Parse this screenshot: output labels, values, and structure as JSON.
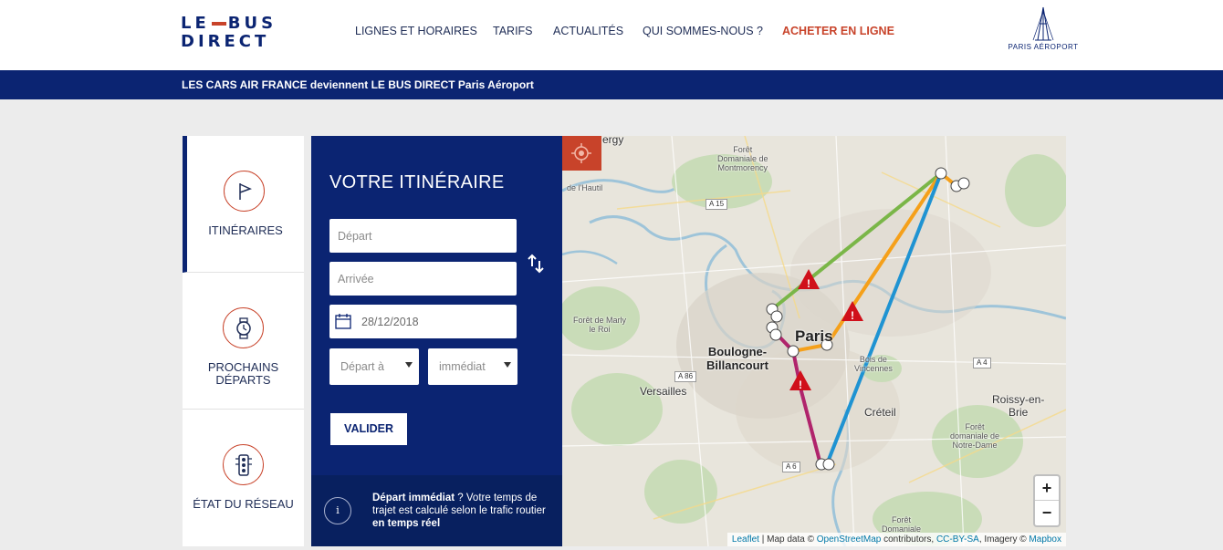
{
  "header": {
    "logo": {
      "line1_a": "LE",
      "line1_b": "BUS",
      "line2": "DIRECT"
    },
    "nav": [
      {
        "label": "LIGNES ET HORAIRES"
      },
      {
        "label": "TARIFS"
      },
      {
        "label": "ACTUALITÉS"
      },
      {
        "label": "QUI SOMMES-NOUS ?"
      },
      {
        "label": "ACHETER EN LIGNE"
      }
    ],
    "partner_logo": "PARIS AÉROPORT"
  },
  "banner": {
    "text": "LES CARS AIR FRANCE deviennent LE BUS DIRECT Paris Aéroport"
  },
  "sidebar": {
    "items": [
      {
        "label": "ITINÉRAIRES",
        "icon": "flag-icon",
        "active": true
      },
      {
        "label": "PROCHAINS DÉPARTS",
        "icon": "watch-icon",
        "active": false
      },
      {
        "label": "ÉTAT DU RÉSEAU",
        "icon": "traffic-light-icon",
        "active": false
      }
    ]
  },
  "form": {
    "title": "VOTRE ITINÉRAIRE",
    "depart_placeholder": "Départ",
    "arrivee_placeholder": "Arrivée",
    "date_value": "28/12/2018",
    "time_mode": "Départ à",
    "time_value": "immédiat",
    "submit_label": "VALIDER",
    "info": {
      "bold1": "Départ immédiat",
      "text1": " ? Votre temps de trajet est calculé selon le trafic routier ",
      "bold2": "en temps réel"
    }
  },
  "map": {
    "labels": {
      "paris": "Paris",
      "boulogne": "Boulogne-\nBillancourt",
      "versailles": "Versailles",
      "creteil": "Créteil",
      "roissy": "Roissy-en-\nBrie",
      "marly": "Forêt de Marly\nle Roi",
      "montmorency": "Forêt\nDomaniale de\nMontmorency",
      "hautil": "de l'Hautil",
      "vincennes": "Bois de\nVincennes",
      "notredame": "Forêt\ndomaniale de\nNotre-Dame",
      "ergy": "ergy",
      "foret_bottom": "Forêt\nDomaniale",
      "a15": "A 15",
      "a86": "A 86",
      "a4": "A 4",
      "a6": "A 6"
    },
    "routes": [
      {
        "name": "green",
        "color": "#7ab648"
      },
      {
        "name": "orange",
        "color": "#f5a01a"
      },
      {
        "name": "blue",
        "color": "#1f93d2"
      },
      {
        "name": "purple",
        "color": "#b0246c"
      }
    ],
    "zoom_in": "+",
    "zoom_out": "−",
    "attribution": {
      "leaflet": "Leaflet",
      "mapdata": " | Map data © ",
      "osm": "OpenStreetMap",
      "contrib": " contributors, ",
      "cc": "CC-BY-SA",
      "imagery": ", Imagery © ",
      "mapbox": "Mapbox"
    }
  }
}
